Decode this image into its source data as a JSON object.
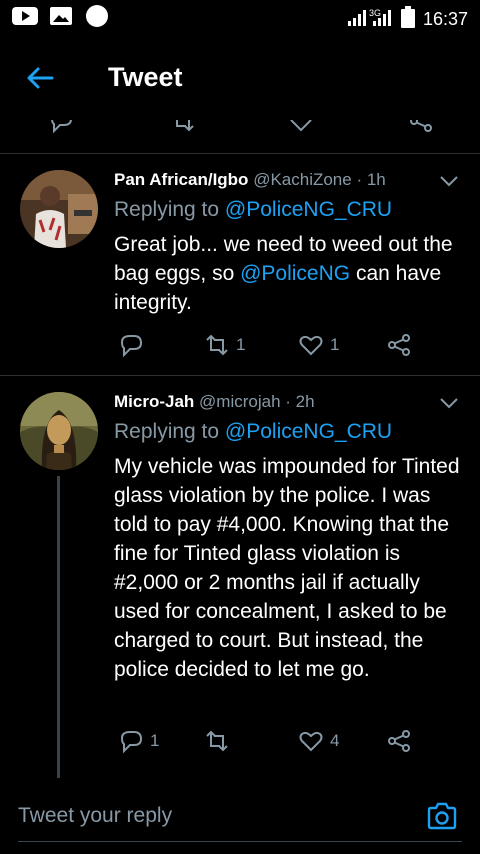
{
  "status_bar": {
    "time": "16:37",
    "network": "3G",
    "icons": [
      "youtube-icon",
      "gallery-icon",
      "circle-icon",
      "signal-icon",
      "battery-icon"
    ]
  },
  "app_bar": {
    "title": "Tweet",
    "back_icon": "arrow-left-icon"
  },
  "tweets": [
    {
      "display_name": "Pan African/Igbo",
      "handle": "@KachiZone",
      "separator": " · ",
      "time": "1h",
      "replying_prefix": "Replying to ",
      "replying_to": "@PoliceNG_CRU",
      "body_before": "Great job... we need to weed out the bag eggs, so ",
      "body_mention": "@PoliceNG",
      "body_after": " can have integrity.",
      "reply_count": "",
      "retweet_count": "1",
      "like_count": "1"
    },
    {
      "display_name": "Micro-Jah",
      "handle": "@microjah",
      "separator": " · ",
      "time": "2h",
      "replying_prefix": "Replying to ",
      "replying_to": "@PoliceNG_CRU",
      "body_before": "My vehicle was impounded for Tinted glass violation by the police. I was told to pay #4,000. Knowing that the fine for Tinted glass violation is #2,000 or 2 months jail if actually used for concealment, I asked to be charged to court. But instead, the police decided to let me go.",
      "body_mention": "",
      "body_after": "",
      "reply_count": "1",
      "retweet_count": "",
      "like_count": "4"
    }
  ],
  "reply_bar": {
    "placeholder": "Tweet your reply",
    "camera_icon": "camera-icon"
  },
  "colors": {
    "background": "#000000",
    "accent": "#1da1f2",
    "muted": "#8899a6",
    "divider": "#2a2f33"
  }
}
